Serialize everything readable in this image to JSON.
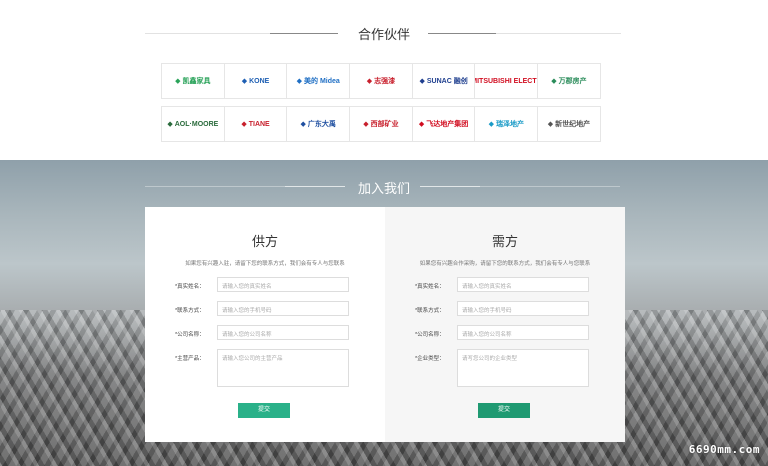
{
  "partners": {
    "title": "合作伙伴",
    "logos": [
      [
        {
          "text": "凯鑫家具",
          "color": "#2aa35a",
          "icon": "leaf-icon"
        },
        {
          "text": "KONE",
          "color": "#1e5fb3",
          "icon": "kone-icon"
        },
        {
          "text": "美的 Midea",
          "color": "#1f6fc4",
          "icon": "midea-icon"
        },
        {
          "text": "志强漆",
          "color": "#c8202d",
          "icon": "zhiqiang-icon"
        },
        {
          "text": "SUNAC 融创",
          "color": "#1f3f8f",
          "icon": "sunac-icon"
        },
        {
          "text": "MITSUBISHI ELECTRIC",
          "color": "#d10c1f",
          "icon": "mitsubishi-icon"
        },
        {
          "text": "万郡房产",
          "color": "#2a8c5a",
          "icon": "wanjun-icon"
        }
      ],
      [
        {
          "text": "AOL·MOORE",
          "color": "#2a6b3c",
          "icon": "aol-icon"
        },
        {
          "text": "TIANE",
          "color": "#c8202d",
          "icon": "tiane-icon"
        },
        {
          "text": "广东大禹",
          "color": "#1f4fa0",
          "icon": "dayu-icon"
        },
        {
          "text": "西部矿业",
          "color": "#c8202d",
          "icon": "western-icon"
        },
        {
          "text": "飞达地产集团",
          "color": "#d10c1f",
          "icon": "feida-icon"
        },
        {
          "text": "瑞泽地产",
          "color": "#1a9bc7",
          "icon": "ruize-icon"
        },
        {
          "text": "新世纪地产",
          "color": "#555555",
          "icon": "xsj-icon"
        }
      ]
    ]
  },
  "join": {
    "title": "加入我们",
    "supplier": {
      "title": "供方",
      "desc": "如果您有兴趣入驻，请留下您的联系方式，我们会有专人与您联系",
      "fields": [
        {
          "label": "*真实姓名：",
          "placeholder": "请输入您的真实姓名"
        },
        {
          "label": "*联系方式：",
          "placeholder": "请输入您的手机号码"
        },
        {
          "label": "*公司名称：",
          "placeholder": "请输入您的公司名称"
        },
        {
          "label": "*主营产品：",
          "placeholder": "请输入您公司的主营产品"
        }
      ],
      "submit": "提交"
    },
    "demand": {
      "title": "需方",
      "desc": "如果您有兴趣合作采购，请留下您的联系方式，我们会有专人与您联系",
      "fields": [
        {
          "label": "*真实姓名：",
          "placeholder": "请输入您的真实姓名"
        },
        {
          "label": "*联系方式：",
          "placeholder": "请输入您的手机号码"
        },
        {
          "label": "*公司名称：",
          "placeholder": "请输入您的公司名称"
        },
        {
          "label": "*企业类型：",
          "placeholder": "请写您公司的企业类型"
        }
      ],
      "submit": "提交"
    }
  },
  "watermark": "6690mm.com",
  "colors": {
    "accent": "#2ab189"
  }
}
